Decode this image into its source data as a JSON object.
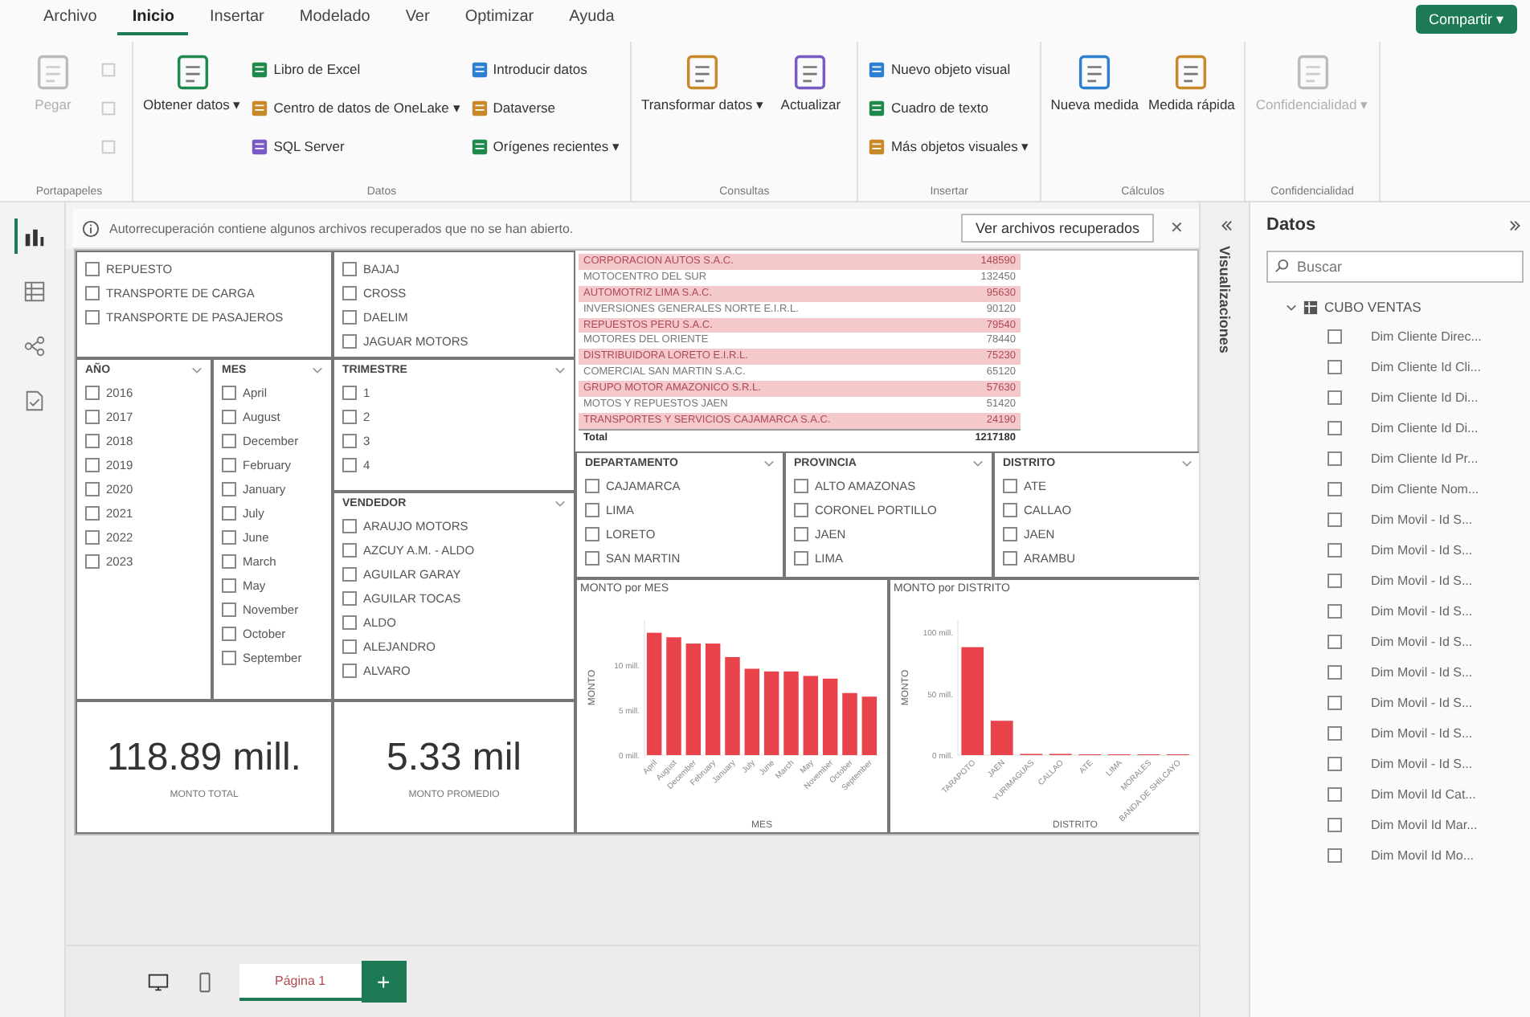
{
  "ribbon": {
    "tabs": [
      {
        "label": "Archivo",
        "selected": false
      },
      {
        "label": "Inicio",
        "selected": true
      },
      {
        "label": "Insertar",
        "selected": false
      },
      {
        "label": "Modelado",
        "selected": false
      },
      {
        "label": "Ver",
        "selected": false
      },
      {
        "label": "Optimizar",
        "selected": false
      },
      {
        "label": "Ayuda",
        "selected": false
      }
    ],
    "share_button": "Compartir ▾",
    "groups": [
      {
        "name": "Portapapeles",
        "items": [
          {
            "kind": "large",
            "label": "Pegar",
            "disabled": true
          },
          {
            "kind": "icon",
            "disabled": true
          },
          {
            "kind": "icon",
            "disabled": true
          },
          {
            "kind": "icon",
            "disabled": true
          }
        ]
      },
      {
        "name": "Datos",
        "items": [
          {
            "kind": "large",
            "label": "Obtener datos ▾",
            "disabled": false
          },
          {
            "kind": "small",
            "label": "Libro de Excel",
            "disabled": false
          },
          {
            "kind": "small",
            "label": "Centro de datos de OneLake ▾",
            "disabled": false
          },
          {
            "kind": "small",
            "label": "SQL Server",
            "disabled": false
          },
          {
            "kind": "small",
            "label": "Introducir datos",
            "disabled": false
          },
          {
            "kind": "small",
            "label": "Dataverse",
            "disabled": false
          },
          {
            "kind": "small",
            "label": "Orígenes recientes ▾",
            "disabled": false
          }
        ]
      },
      {
        "name": "Consultas",
        "items": [
          {
            "kind": "large",
            "label": "Transformar datos ▾",
            "disabled": false
          },
          {
            "kind": "large",
            "label": "Actualizar",
            "disabled": false
          }
        ]
      },
      {
        "name": "Insertar",
        "items": [
          {
            "kind": "small",
            "label": "Nuevo objeto visual",
            "disabled": false
          },
          {
            "kind": "small",
            "label": "Cuadro de texto",
            "disabled": false
          },
          {
            "kind": "small",
            "label": "Más objetos visuales ▾",
            "disabled": false
          }
        ]
      },
      {
        "name": "Cálculos",
        "items": [
          {
            "kind": "large",
            "label": "Nueva medida",
            "disabled": false
          },
          {
            "kind": "large",
            "label": "Medida rápida",
            "disabled": false
          }
        ]
      },
      {
        "name": "Confidencialidad",
        "items": [
          {
            "kind": "large",
            "label": "Confidencialidad ▾",
            "disabled": true
          }
        ]
      }
    ]
  },
  "left_rail": [
    {
      "selected": true
    },
    {
      "selected": false
    },
    {
      "selected": false
    },
    {
      "selected": false
    }
  ],
  "message_bar": {
    "text": "Autorrecuperación contiene algunos archivos recuperados que no se han abierto.",
    "button": "Ver archivos recuperados",
    "close": "✕"
  },
  "canvas": {
    "slicers_top": [
      {
        "items": [
          {
            "label": "REPUESTO",
            "checked": false
          },
          {
            "label": "TRANSPORTE DE CARGA",
            "checked": false
          },
          {
            "label": "TRANSPORTE DE PASAJEROS",
            "checked": false
          }
        ]
      },
      {
        "items": [
          {
            "label": "BAJAJ",
            "checked": false
          },
          {
            "label": "CROSS",
            "checked": false
          },
          {
            "label": "DAELIM",
            "checked": false
          },
          {
            "label": "JAGUAR MOTORS",
            "checked": false
          }
        ]
      }
    ],
    "slicer_year": {
      "title": "AÑO",
      "items": [
        {
          "label": "2016",
          "checked": false
        },
        {
          "label": "2017",
          "checked": false
        },
        {
          "label": "2018",
          "checked": false
        },
        {
          "label": "2019",
          "checked": false
        },
        {
          "label": "2020",
          "checked": false
        },
        {
          "label": "2021",
          "checked": false
        },
        {
          "label": "2022",
          "checked": false
        },
        {
          "label": "2023",
          "checked": false
        }
      ]
    },
    "slicer_month": {
      "title": "MES",
      "items": [
        {
          "label": "April",
          "checked": false
        },
        {
          "label": "August",
          "checked": false
        },
        {
          "label": "December",
          "checked": false
        },
        {
          "label": "February",
          "checked": false
        },
        {
          "label": "January",
          "checked": false
        },
        {
          "label": "July",
          "checked": false
        },
        {
          "label": "June",
          "checked": false
        },
        {
          "label": "March",
          "checked": false
        },
        {
          "label": "May",
          "checked": false
        },
        {
          "label": "November",
          "checked": false
        },
        {
          "label": "October",
          "checked": false
        },
        {
          "label": "September",
          "checked": false
        }
      ]
    },
    "slicer_quarter": {
      "title": "TRIMESTRE",
      "items": [
        {
          "label": "1",
          "checked": false
        },
        {
          "label": "2",
          "checked": false
        },
        {
          "label": "3",
          "checked": false
        },
        {
          "label": "4",
          "checked": false
        }
      ]
    },
    "slicer_seller": {
      "title": "VENDEDOR",
      "items": [
        {
          "label": "ARAUJO MOTORS",
          "checked": false
        },
        {
          "label": "AZCUY A.M. - ALDO",
          "checked": false
        },
        {
          "label": "AGUILAR GARAY",
          "checked": false
        },
        {
          "label": "AGUILAR TOCAS",
          "checked": false
        },
        {
          "label": "ALDO",
          "checked": false
        },
        {
          "label": "ALEJANDRO",
          "checked": false
        },
        {
          "label": "ALVARO",
          "checked": false
        }
      ]
    },
    "cards": [
      {
        "value": "118.89 mill.",
        "label": "MONTO TOTAL"
      },
      {
        "value": "5.33 mil",
        "label": "MONTO PROMEDIO"
      }
    ],
    "matrix": {
      "rows": [
        {
          "name": "CORPORACION AUTOS S.A.C.",
          "value": "148590"
        },
        {
          "name": "MOTOCENTRO DEL SUR",
          "value": "132450"
        },
        {
          "name": "AUTOMOTRIZ LIMA S.A.C.",
          "value": "95630"
        },
        {
          "name": "INVERSIONES GENERALES NORTE E.I.R.L.",
          "value": "90120"
        },
        {
          "name": "REPUESTOS PERU S.A.C.",
          "value": "79540"
        },
        {
          "name": "MOTORES DEL ORIENTE",
          "value": "78440"
        },
        {
          "name": "DISTRIBUIDORA LORETO E.I.R.L.",
          "value": "75230"
        },
        {
          "name": "COMERCIAL SAN MARTIN S.A.C.",
          "value": "65120"
        },
        {
          "name": "GRUPO MOTOR AMAZONICO S.R.L.",
          "value": "57630"
        },
        {
          "name": "MOTOS Y REPUESTOS JAEN",
          "value": "51420"
        },
        {
          "name": "TRANSPORTES Y SERVICIOS CAJAMARCA S.A.C.",
          "value": "24190"
        }
      ],
      "total_label": "Total",
      "total_value": "1217180"
    },
    "slicers_geo": [
      {
        "title": "DEPARTAMENTO",
        "items": [
          {
            "label": "CAJAMARCA",
            "checked": false
          },
          {
            "label": "LIMA",
            "checked": false
          },
          {
            "label": "LORETO",
            "checked": false
          },
          {
            "label": "SAN MARTIN",
            "checked": false
          }
        ]
      },
      {
        "title": "PROVINCIA",
        "items": [
          {
            "label": "ALTO AMAZONAS",
            "checked": false
          },
          {
            "label": "CORONEL PORTILLO",
            "checked": false
          },
          {
            "label": "JAEN",
            "checked": false
          },
          {
            "label": "LIMA",
            "checked": false
          }
        ]
      },
      {
        "title": "DISTRITO",
        "items": [
          {
            "label": "ATE",
            "checked": false
          },
          {
            "label": "CALLAO",
            "checked": false
          },
          {
            "label": "JAEN",
            "checked": false
          },
          {
            "label": "ARAMBU",
            "checked": false
          }
        ]
      }
    ],
    "charts": [
      {
        "chart_data": {
          "type": "bar",
          "title": "MONTO por MES",
          "xlabel": "MES",
          "ylabel": "MONTO",
          "categories": [
            "April",
            "August",
            "December",
            "February",
            "January",
            "July",
            "June",
            "March",
            "May",
            "November",
            "October",
            "September"
          ],
          "series": [
            {
              "color": "#e8434a",
              "values": [
                13.6,
                13.1,
                12.4,
                12.4,
                10.9,
                9.6,
                9.3,
                9.3,
                8.8,
                8.5,
                6.9,
                6.5
              ]
            }
          ],
          "ylim": [
            0,
            15
          ],
          "yticks": [
            {
              "value": 0,
              "label": "0 mill."
            },
            {
              "value": 5,
              "label": "5 mill."
            },
            {
              "value": 10,
              "label": "10 mill."
            }
          ]
        }
      },
      {
        "chart_data": {
          "type": "bar",
          "title": "MONTO por DISTRITO",
          "xlabel": "DISTRITO",
          "ylabel": "MONTO",
          "categories": [
            "TARAPOTO",
            "JAEN",
            "YURIMAGUAS",
            "CALLAO",
            "ATE",
            "LIMA",
            "MORALES",
            "BANDA DE SHILCAYO"
          ],
          "series": [
            {
              "color": "#e8434a",
              "values": [
                88,
                28,
                1,
                1,
                0,
                0,
                0,
                0
              ]
            }
          ],
          "ylim": [
            0,
            110
          ],
          "yticks": [
            {
              "value": 0,
              "label": "0 mill."
            },
            {
              "value": 50,
              "label": "50 mill."
            },
            {
              "value": 100,
              "label": "100 mill."
            }
          ]
        }
      }
    ]
  },
  "page_tabs": {
    "tabs": [
      {
        "label": "Página 1",
        "selected": true
      }
    ],
    "add_button": "+"
  },
  "visualizations_pane": {
    "title": "Visualizaciones"
  },
  "data_pane": {
    "title": "Datos",
    "search": {
      "placeholder": "Buscar"
    },
    "tree": [
      {
        "label": "CUBO VENTAS",
        "expanded": true,
        "children": [
          {
            "label": "Dim Cliente Direc...",
            "checked": false
          },
          {
            "label": "Dim Cliente Id Cli...",
            "checked": false
          },
          {
            "label": "Dim Cliente Id Di...",
            "checked": false
          },
          {
            "label": "Dim Cliente Id Di...",
            "checked": false
          },
          {
            "label": "Dim Cliente Id Pr...",
            "checked": false
          },
          {
            "label": "Dim Cliente Nom...",
            "checked": false
          },
          {
            "label": "Dim Movil - Id S...",
            "checked": false
          },
          {
            "label": "Dim Movil - Id S...",
            "checked": false
          },
          {
            "label": "Dim Movil - Id S...",
            "checked": false
          },
          {
            "label": "Dim Movil - Id S...",
            "checked": false
          },
          {
            "label": "Dim Movil - Id S...",
            "checked": false
          },
          {
            "label": "Dim Movil - Id S...",
            "checked": false
          },
          {
            "label": "Dim Movil - Id S...",
            "checked": false
          },
          {
            "label": "Dim Movil - Id S...",
            "checked": false
          },
          {
            "label": "Dim Movil - Id S...",
            "checked": false
          },
          {
            "label": "Dim Movil Id Cat...",
            "checked": false
          },
          {
            "label": "Dim Movil Id Mar...",
            "checked": false
          },
          {
            "label": "Dim Movil Id Mo...",
            "checked": false
          }
        ]
      }
    ]
  }
}
